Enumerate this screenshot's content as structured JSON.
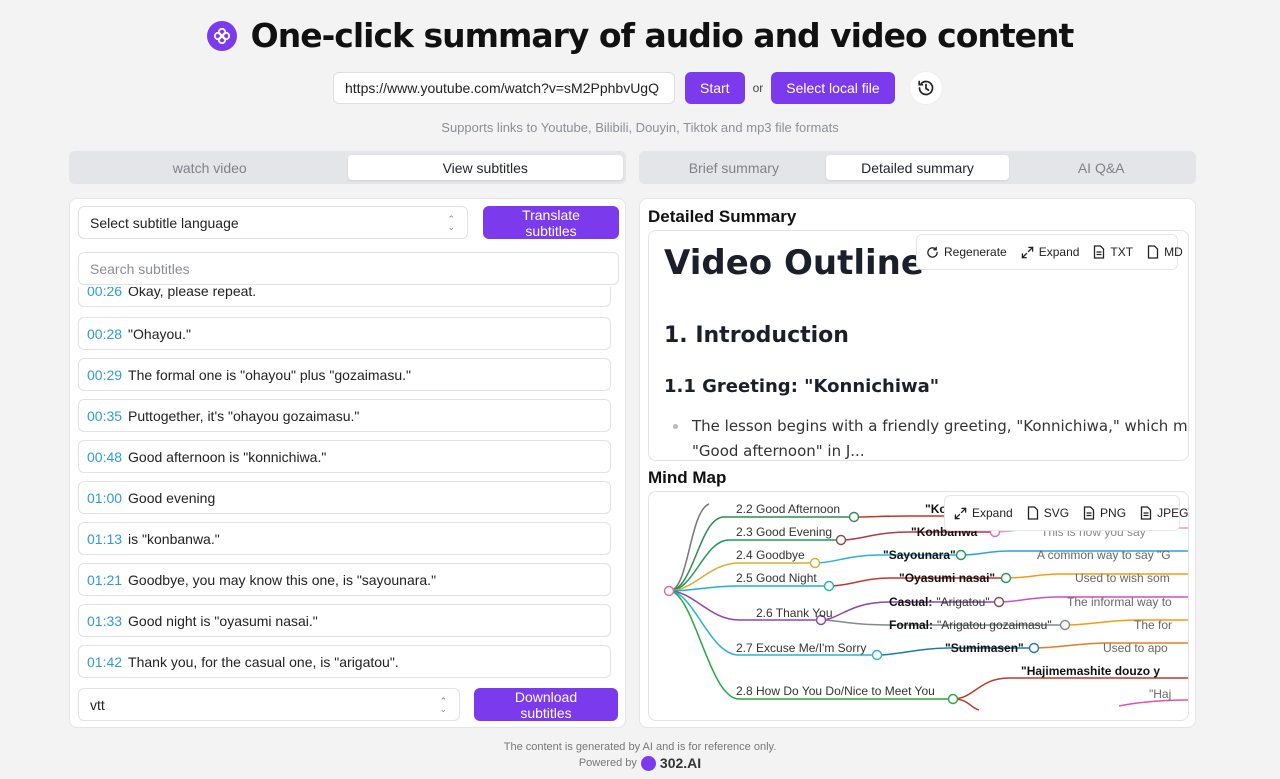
{
  "header": {
    "title": "One-click summary of audio and video content",
    "logo_icon": "flower-logo-icon"
  },
  "url_bar": {
    "url_value": "https://www.youtube.com/watch?v=sM2PphbvUgQ",
    "start_label": "Start",
    "or_label": "or",
    "local_file_label": "Select local file",
    "history_icon": "history-icon"
  },
  "support_text": "Supports links to Youtube, Bilibili, Douyin, Tiktok and mp3 file formats",
  "left_tabs": [
    {
      "label": "watch video",
      "active": false
    },
    {
      "label": "View subtitles",
      "active": true
    }
  ],
  "right_tabs": [
    {
      "label": "Brief summary",
      "active": false
    },
    {
      "label": "Detailed summary",
      "active": true
    },
    {
      "label": "AI Q&A",
      "active": false
    }
  ],
  "subtitles": {
    "language_placeholder": "Select subtitle language",
    "translate_label": "Translate subtitles",
    "search_placeholder": "Search subtitles",
    "items": [
      {
        "time": "00:26",
        "text": "Okay, please repeat."
      },
      {
        "time": "00:28",
        "text": "\"Ohayou.\""
      },
      {
        "time": "00:29",
        "text": "The formal one is \"ohayou\" plus \"gozaimasu.\""
      },
      {
        "time": "00:35",
        "text": "Puttogether, it's \"ohayou gozaimasu.\""
      },
      {
        "time": "00:48",
        "text": "Good afternoon is \"konnichiwa.\""
      },
      {
        "time": "01:00",
        "text": "Good evening"
      },
      {
        "time": "01:13",
        "text": "is \"konbanwa.\""
      },
      {
        "time": "01:21",
        "text": "Goodbye, you may know this one, is \"sayounara.\""
      },
      {
        "time": "01:33",
        "text": "Good night is \"oyasumi nasai.\""
      },
      {
        "time": "01:42",
        "text": "Thank you, for the casual one, is \"arigatou\"."
      }
    ],
    "format_value": "vtt",
    "download_label": "Download subtitles"
  },
  "detailed": {
    "section_title": "Detailed Summary",
    "toolbar": {
      "regenerate": "Regenerate",
      "expand": "Expand",
      "txt": "TXT",
      "md": "MD"
    },
    "outline": {
      "h1": "Video Outline",
      "h2": "1. Introduction",
      "h3": "1.1 Greeting: \"Konnichiwa\"",
      "bullet": "The lesson begins with a friendly greeting, \"Konnichiwa,\" which means",
      "bullet_cont": "\"Good afternoon\" in J..."
    }
  },
  "mindmap": {
    "section_title": "Mind Map",
    "toolbar": {
      "expand": "Expand",
      "svg": "SVG",
      "png": "PNG",
      "jpeg": "JPEG"
    },
    "nodes": {
      "n22": "2.2 Good Afternoon",
      "n23": "2.3 Good Evening",
      "n24": "2.4 Goodbye",
      "n25": "2.5 Good Night",
      "n26": "2.6 Thank You",
      "n27": "2.7 Excuse Me/I'm Sorry",
      "n28": "2.8 How Do You Do/Nice to Meet You",
      "konbanwa": "\"Konbanwa\"",
      "sayounara": "\"Sayounara\"",
      "oyasumi": "\"Oyasumi nasai\"",
      "casual_label": "Casual:",
      "casual_val": "\"Arigatou\"",
      "formal_label": "Formal:",
      "formal_val": "\"Arigatou gozaimasu\"",
      "sumimasen": "\"Sumimasen\"",
      "hajime": "\"Hajimemashite douzo y",
      "hajime2": "\"Haj",
      "ko": "\"Ko",
      "desc23": "This is how you say",
      "desc24": "A common way to say \"G",
      "desc25": "Used to wish som",
      "desc26a": "The informal way to",
      "desc26b": "The for",
      "desc27": "Used to apo"
    }
  },
  "footer": {
    "disclaimer": "The content is generated by AI and is for reference only.",
    "powered_by": "Powered by",
    "brand": "302.AI"
  },
  "colors": {
    "accent": "#7c3aed",
    "timestamp": "#2f9bd8"
  }
}
